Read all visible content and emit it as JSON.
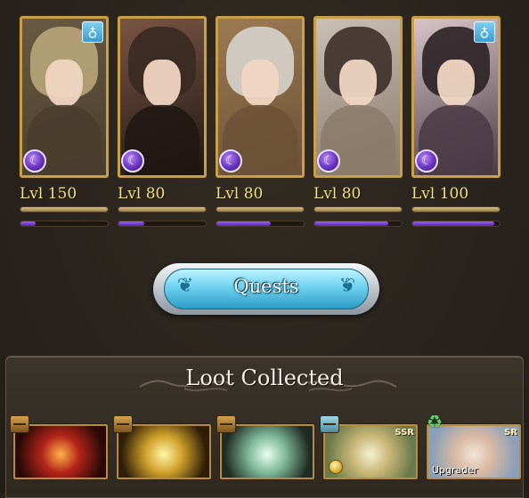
{
  "party": [
    {
      "level_text": "Lvl 150",
      "element_icon": "dark-element-icon",
      "ring": true,
      "ring_icon": "ring-icon",
      "level_bar": 1.0,
      "exp_bar": 0.17,
      "palette": [
        "#b8a57a",
        "#4a3d2d",
        "#6a5a44"
      ]
    },
    {
      "level_text": "Lvl 80",
      "element_icon": "dark-element-icon",
      "ring": false,
      "level_bar": 1.0,
      "exp_bar": 0.3,
      "palette": [
        "#3a2a22",
        "#1f1613",
        "#7a5544"
      ]
    },
    {
      "level_text": "Lvl 80",
      "element_icon": "dark-element-icon",
      "ring": false,
      "level_bar": 1.0,
      "exp_bar": 0.62,
      "palette": [
        "#d7d3cc",
        "#6b5136",
        "#9c7a52"
      ]
    },
    {
      "level_text": "Lvl 80",
      "element_icon": "dark-element-icon",
      "ring": false,
      "level_bar": 1.0,
      "exp_bar": 0.85,
      "palette": [
        "#3d302a",
        "#8a7a6a",
        "#c9c0b4"
      ]
    },
    {
      "level_text": "Lvl 100",
      "element_icon": "dark-element-icon",
      "ring": true,
      "ring_icon": "ring-icon",
      "level_bar": 1.0,
      "exp_bar": 0.94,
      "palette": [
        "#2b2226",
        "#4a3a44",
        "#d8c4c8"
      ]
    }
  ],
  "quests_button": {
    "label": "Quests"
  },
  "loot": {
    "title": "Loot Collected",
    "items": [
      {
        "name": "fire-quartz",
        "chest_icon": "treasure-chest-icon",
        "art": [
          "#ffb24a",
          "#b3241a",
          "#2a0a06"
        ]
      },
      {
        "name": "light-orb",
        "chest_icon": "treasure-chest-icon",
        "art": [
          "#fff6a8",
          "#cfa12a",
          "#2e1d08"
        ]
      },
      {
        "name": "wind-orb",
        "chest_icon": "treasure-chest-icon",
        "art": [
          "#e9fff0",
          "#7fb89a",
          "#1e2a22"
        ]
      },
      {
        "name": "weapon-ssr",
        "chest_icon": "blue-chest-icon",
        "rarity": "SSR",
        "coin": true,
        "art": [
          "#f4f0d0",
          "#c9b777",
          "#6a7a4a"
        ]
      },
      {
        "name": "summon-sr",
        "recycle_icon": "recycle-icon",
        "rarity": "SR",
        "upgrader_label": "Upgrader",
        "art": [
          "#f2e4d8",
          "#d9b9a2",
          "#8aa0b8"
        ]
      }
    ]
  },
  "colors": {
    "frame_gold": "#c9a04a",
    "level_text": "#f2e27a",
    "exp_purple": "#7a41dc",
    "button_blue": "#6fd2ef"
  }
}
